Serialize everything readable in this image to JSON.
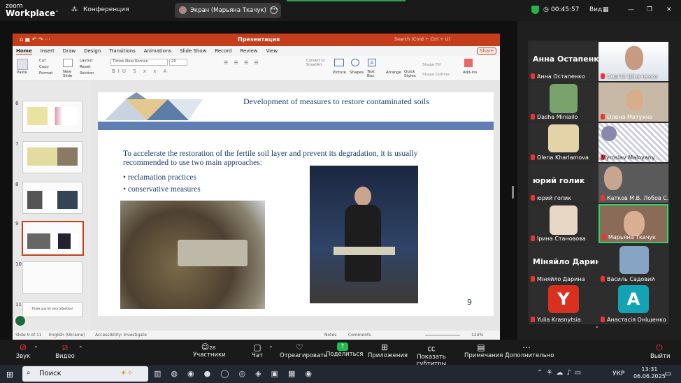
{
  "app": {
    "logo_line1": "zoom",
    "logo_line2": "Workplace",
    "conference_label": "Конференция",
    "screen_share_label": "Экран (Марьяна Ткачук)",
    "timer": "00:45:57",
    "view_label": "Вид"
  },
  "ppt": {
    "window_title": "Презентация",
    "search_placeholder": "Search (Cmd + Ctrl + U)",
    "share_label": "Share",
    "tabs": [
      "Home",
      "Insert",
      "Draw",
      "Design",
      "Transitions",
      "Animations",
      "Slide Show",
      "Record",
      "Review",
      "View"
    ],
    "ribbon": {
      "paste": "Paste",
      "cut": "Cut",
      "copy": "Copy",
      "format": "Format",
      "new_slide": "New Slide",
      "layout": "Layout",
      "reset": "Reset",
      "section": "Section",
      "font": "Times New Roman",
      "size": "20",
      "convert": "Convert to SmartArt",
      "picture": "Picture",
      "shapes": "Shapes",
      "textbox": "Text Box",
      "arrange": "Arrange",
      "quick_styles": "Quick Styles",
      "shape_fill": "Shape Fill",
      "shape_outline": "Shape Outline",
      "addins": "Add-ins"
    },
    "thumb_numbers": [
      "6",
      "7",
      "8",
      "9",
      "10",
      "11"
    ],
    "thumb11_text": "Thank you for your attention!",
    "slide": {
      "title": "Development of measures to restore contaminated soils",
      "body": "To accelerate the restoration of the fertile soil layer and prevent its degradation, it is usually recommended to use two main approaches:",
      "bullets": [
        "reclamation practices",
        "conservative measures"
      ],
      "page_number": "9"
    },
    "status": {
      "slide_of": "Slide 9 of 11",
      "language": "English (Ukraine)",
      "accessibility": "Accessibility: Investigate",
      "notes": "Notes",
      "comments": "Comments",
      "zoom": "124%"
    }
  },
  "gallery": [
    {
      "name": "Анна Остапенко",
      "big": "Анна Остапенко"
    },
    {
      "name": "Сергій Шевченко"
    },
    {
      "name": "Dasha Miniailo"
    },
    {
      "name": "Олена Матухно"
    },
    {
      "name": "Olena Kharlamova"
    },
    {
      "name": "Myroslav Maloyany..."
    },
    {
      "name": "юрий голик",
      "big": "юрий голик"
    },
    {
      "name": "Катков М.В. Лобов С.О."
    },
    {
      "name": "Ірина Становова"
    },
    {
      "name": "Марьяна Ткачук"
    },
    {
      "name": "Міняйло Дарина",
      "big": "Міняйло Дарина"
    },
    {
      "name": "Василь Садовий"
    },
    {
      "name": "Yulia Krasnytsia",
      "letter": "Y"
    },
    {
      "name": "Анастасія Оніщенко",
      "letter": "A"
    }
  ],
  "toolbar": {
    "audio": "Звук",
    "video": "Видео",
    "participants": "Участники",
    "participants_count": "28",
    "chat": "Чат",
    "react": "Отреагировать",
    "share": "Поделиться",
    "apps": "Приложения",
    "captions": "Показать субтитры",
    "notes": "Примечания",
    "more": "Дополнительно",
    "leave": "Выйти"
  },
  "taskbar": {
    "search": "Поиск",
    "lang": "УКР",
    "time": "13:31",
    "date": "06.06.2025"
  }
}
